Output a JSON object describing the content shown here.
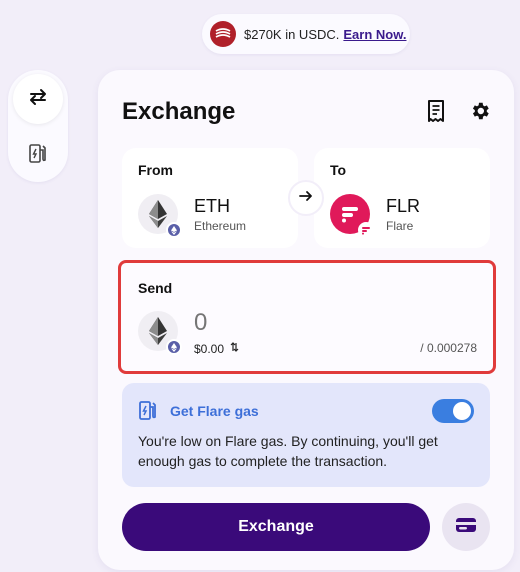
{
  "promo": {
    "text": "$270K in USDC.",
    "cta": "Earn Now."
  },
  "sidebar": {
    "items": [
      {
        "icon": "swap-arrows-icon"
      },
      {
        "icon": "gas-pump-icon"
      }
    ]
  },
  "exchange": {
    "title": "Exchange",
    "from": {
      "label": "From",
      "symbol": "ETH",
      "name": "Ethereum"
    },
    "to": {
      "label": "To",
      "symbol": "FLR",
      "name": "Flare"
    },
    "send": {
      "label": "Send",
      "amount": "0",
      "fiat": "$0.00",
      "balance": "/ 0.000278"
    },
    "gas": {
      "title": "Get Flare gas",
      "text": "You're low on Flare gas. By continuing, you'll get enough gas to complete the transaction.",
      "enabled": true
    },
    "button": "Exchange"
  },
  "colors": {
    "accent": "#3a0a7a",
    "flare": "#e0195a",
    "link": "#3d6fd8",
    "highlight_border": "#e03b3b"
  }
}
